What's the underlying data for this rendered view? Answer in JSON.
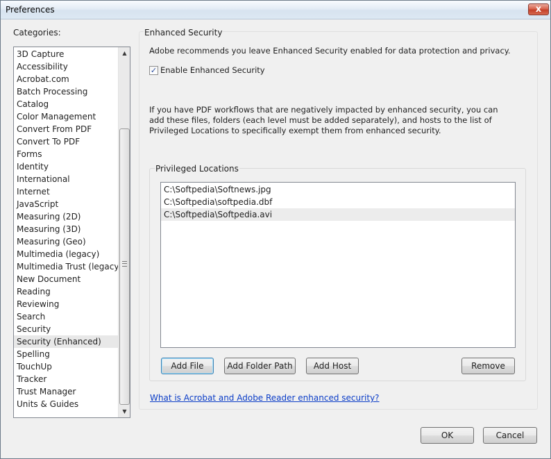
{
  "window": {
    "title": "Preferences",
    "close_label": "x"
  },
  "categories": {
    "label": "Categories:",
    "items": [
      "3D Capture",
      "Accessibility",
      "Acrobat.com",
      "Batch Processing",
      "Catalog",
      "Color Management",
      "Convert From PDF",
      "Convert To PDF",
      "Forms",
      "Identity",
      "International",
      "Internet",
      "JavaScript",
      "Measuring (2D)",
      "Measuring (3D)",
      "Measuring (Geo)",
      "Multimedia (legacy)",
      "Multimedia Trust (legacy)",
      "New Document",
      "Reading",
      "Reviewing",
      "Search",
      "Security",
      "Security (Enhanced)",
      "Spelling",
      "TouchUp",
      "Tracker",
      "Trust Manager",
      "Units & Guides"
    ],
    "selected": "Security (Enhanced)",
    "scroll_up_glyph": "▲",
    "scroll_down_glyph": "▼"
  },
  "enhanced_security": {
    "title": "Enhanced Security",
    "recommendation": "Adobe recommends you leave Enhanced Security enabled for data protection and privacy.",
    "checkbox_label": "Enable Enhanced Security",
    "checkbox_checked": true,
    "checkbox_glyph": "✓",
    "description": "If you have PDF workflows that are negatively impacted by enhanced security, you can add these files, folders (each level must be added separately), and hosts to the list of Privileged Locations to specifically exempt them from enhanced security."
  },
  "privileged_locations": {
    "title": "Privileged Locations",
    "items": [
      "C:\\Softpedia\\Softnews.jpg",
      "C:\\Softpedia\\softpedia.dbf",
      "C:\\Softpedia\\Softpedia.avi"
    ],
    "selected_index": 2,
    "buttons": {
      "add_file": "Add File",
      "add_folder_path": "Add Folder Path",
      "add_host": "Add Host",
      "remove": "Remove"
    }
  },
  "help_link": "What is Acrobat and Adobe Reader enhanced security?",
  "footer": {
    "ok": "OK",
    "cancel": "Cancel"
  }
}
